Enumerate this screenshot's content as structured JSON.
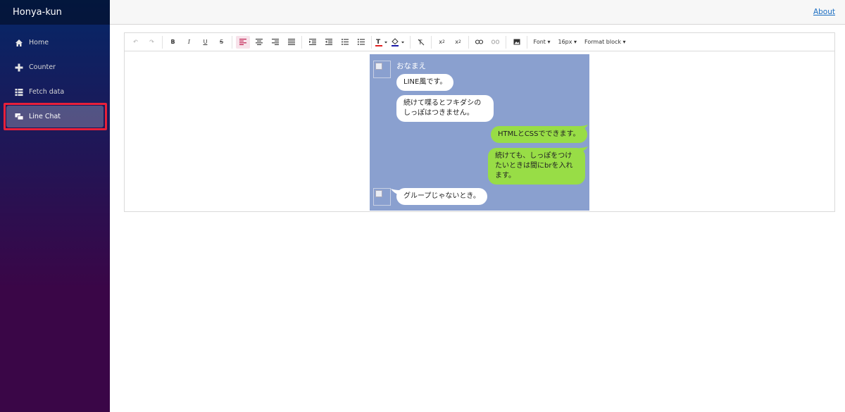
{
  "app": {
    "brand": "Honya-kun"
  },
  "sidebar": {
    "items": [
      {
        "label": "Home",
        "icon": "home-icon"
      },
      {
        "label": "Counter",
        "icon": "plus-icon"
      },
      {
        "label": "Fetch data",
        "icon": "list-icon"
      },
      {
        "label": "Line Chat",
        "icon": "chat-icon",
        "active": true
      }
    ]
  },
  "topbar": {
    "about": "About"
  },
  "toolbar": {
    "font": "Font",
    "size": "16px",
    "format": "Format block",
    "colors": {
      "text_color": "#e02020",
      "highlight": "#1a1aa8",
      "active_bg": "#f7e2ea"
    }
  },
  "chat": {
    "background": "#8aa0cf",
    "name": "おなまえ",
    "messages": [
      {
        "side": "left",
        "text": "LINE風です。"
      },
      {
        "side": "left",
        "text": "続けて喋るとフキダシのしっぽはつきません。"
      },
      {
        "side": "right",
        "text": "HTMLとCSSでできます。"
      },
      {
        "side": "right",
        "text": "続けても、しっぽをつけたいときは間にbrを入れます。"
      },
      {
        "side": "left",
        "text": "グループじゃないとき。"
      }
    ]
  }
}
